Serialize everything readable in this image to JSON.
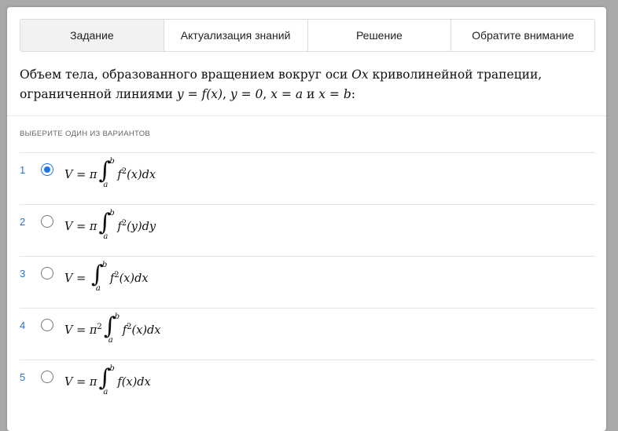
{
  "tabs": [
    {
      "label": "Задание",
      "active": true
    },
    {
      "label": "Актуализация знаний",
      "active": false
    },
    {
      "label": "Решение",
      "active": false
    },
    {
      "label": "Обратите внимание",
      "active": false
    }
  ],
  "question": {
    "text_1": "Объем тела, образованного вращением вокруг оси ",
    "axis": "Ox",
    "text_2": " криволинейной трапеции, ограниченной линиями ",
    "eq1": "y = f(x)",
    "eq2": "y = 0",
    "eq3": "x = a",
    "and_word": " и ",
    "eq4": "x = b"
  },
  "hint": "ВЫБЕРИТЕ ОДИН ИЗ ВАРИАНТОВ",
  "options": [
    {
      "num": "1",
      "prefix": "V = π",
      "integrand": "f",
      "power": "2",
      "rest": "(x)dx",
      "upper": "b",
      "lower": "a",
      "checked": true
    },
    {
      "num": "2",
      "prefix": "V = π",
      "integrand": "f",
      "power": "2",
      "rest": "(y)dy",
      "upper": "b",
      "lower": "a",
      "checked": false
    },
    {
      "num": "3",
      "prefix": "V = ",
      "integrand": "f",
      "power": "2",
      "rest": "(x)dx",
      "upper": "b",
      "lower": "a",
      "checked": false
    },
    {
      "num": "4",
      "prefix": "V = π",
      "prefix_power": "2",
      "integrand": "f",
      "power": "2",
      "rest": "(x)dx",
      "upper": "b",
      "lower": "a",
      "checked": false
    },
    {
      "num": "5",
      "prefix": "V = π",
      "integrand": "f",
      "power": "",
      "rest": "(x)dx",
      "upper": "b",
      "lower": "a",
      "checked": false
    }
  ],
  "colors": {
    "accent": "#1a73e8",
    "number": "#2f72c4",
    "background": "#a9a9a9"
  }
}
